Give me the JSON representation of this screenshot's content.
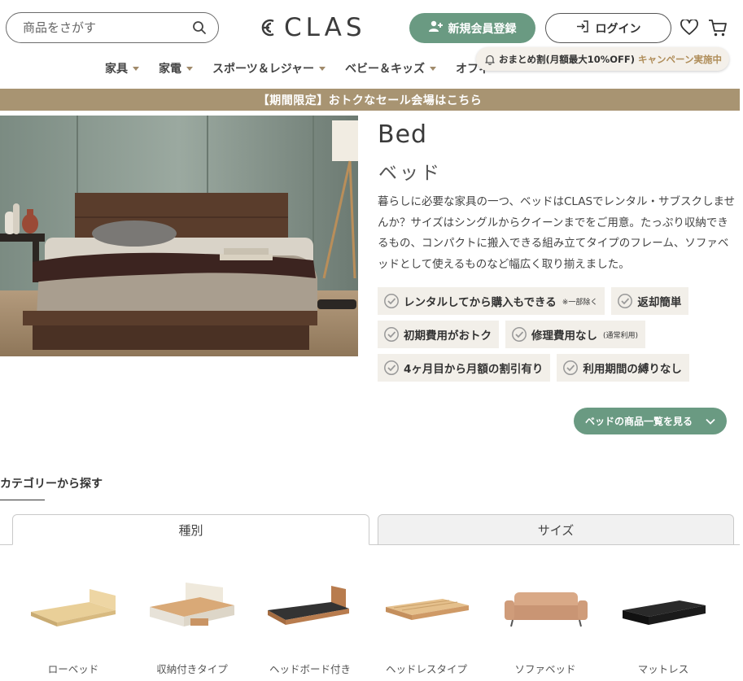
{
  "header": {
    "search_placeholder": "商品をさがす",
    "logo_text": "CLAS",
    "register_label": "新規会員登録",
    "login_label": "ログイン"
  },
  "nav": {
    "items": [
      "家具",
      "家電",
      "スポーツ＆レジャー",
      "ベビー＆キッズ",
      "オフィ"
    ]
  },
  "promo": {
    "main": "おまとめ割(月額最大10%OFF)",
    "accent": "キャンペーン実施中"
  },
  "banner": {
    "text": "【期間限定】おトクなセール会場はこちら"
  },
  "hero": {
    "title_en": "Bed",
    "title_ja": "ベッド",
    "description": "暮らしに必要な家具の一つ、ベッドはCLASでレンタル・サブスクしませんか？サイズはシングルからクイーンまでをご用意。たっぷり収納できるもの、コンパクトに搬入できる組み立てタイプのフレーム、ソファベッドとして使えるものなど幅広く取り揃えました。",
    "tags": [
      {
        "text": "レンタルしてから購入もできる",
        "note": "※一部除く"
      },
      {
        "text": "返却簡単",
        "note": ""
      },
      {
        "text": "初期費用がおトク",
        "note": ""
      },
      {
        "text": "修理費用なし",
        "note": "(通常利用)"
      },
      {
        "text": "4ヶ月目から月額の割引有り",
        "note": ""
      },
      {
        "text": "利用期間の縛りなし",
        "note": ""
      }
    ],
    "more_button": "ベッドの商品一覧を見る"
  },
  "category": {
    "title": "カテゴリーから探す",
    "tabs": [
      "種別",
      "サイズ"
    ],
    "products": [
      "ローベッド",
      "収納付きタイプ",
      "ヘッドボード付き",
      "ヘッドレスタイプ",
      "ソファベッド",
      "マットレス"
    ]
  },
  "colors": {
    "accent_green": "#6a9a82",
    "banner_tan": "#a89472",
    "promo_gold": "#b08e5a"
  }
}
